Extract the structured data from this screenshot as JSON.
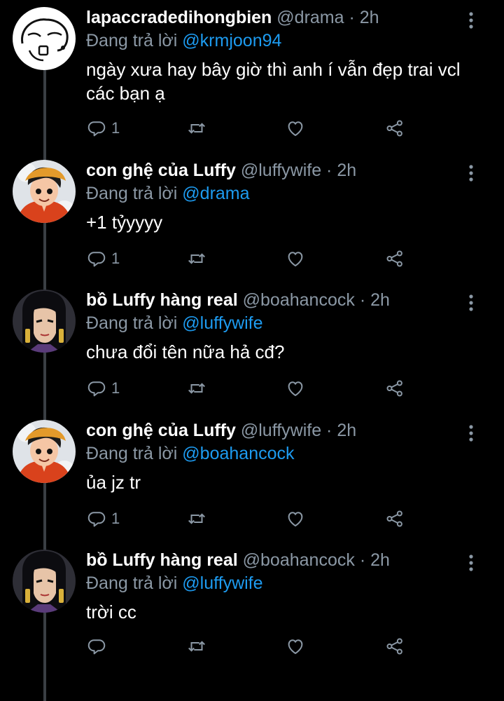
{
  "reply_prefix": "Đang trả lời",
  "colors": {
    "background": "#000000",
    "secondary_text": "#8b98a5",
    "link": "#1d9bf0",
    "thread_line": "#3a3f44"
  },
  "tweets": [
    {
      "display_name": "lapaccradedihongbien",
      "handle": "@drama",
      "time": "· 2h",
      "reply_to": "@krmjoon94",
      "text": "ngày xưa hay bây giờ thì anh í vẫn đẹp trai vcl các bạn ạ",
      "reply_count": "1",
      "avatar": "sketch-avatar"
    },
    {
      "display_name": "con ghệ của Luffy",
      "handle": "@luffywife",
      "time": "· 2h",
      "reply_to": "@drama",
      "text": "+1 tỷyyyy",
      "reply_count": "1",
      "avatar": "luffy-avatar"
    },
    {
      "display_name": "bồ Luffy hàng real",
      "handle": "@boahancock",
      "time": "· 2h",
      "reply_to": "@luffywife",
      "text": "chưa đổi tên nữa hả cđ?",
      "reply_count": "1",
      "avatar": "hancock-avatar"
    },
    {
      "display_name": "con ghệ của Luffy",
      "handle": "@luffywife",
      "time": "· 2h",
      "reply_to": "@boahancock",
      "text": "ủa jz tr",
      "reply_count": "1",
      "avatar": "luffy-avatar"
    },
    {
      "display_name": "bồ Luffy hàng real",
      "handle": "@boahancock",
      "time": "· 2h",
      "reply_to": "@luffywife",
      "text": "trời cc",
      "reply_count": "",
      "avatar": "hancock-avatar"
    }
  ]
}
